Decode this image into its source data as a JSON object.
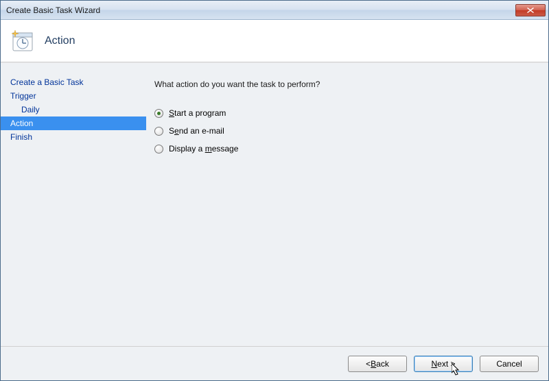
{
  "titlebar": {
    "text": "Create Basic Task Wizard"
  },
  "header": {
    "title": "Action"
  },
  "sidebar": {
    "items": [
      {
        "label": "Create a Basic Task",
        "indent": false,
        "active": false
      },
      {
        "label": "Trigger",
        "indent": false,
        "active": false
      },
      {
        "label": "Daily",
        "indent": true,
        "active": false
      },
      {
        "label": "Action",
        "indent": false,
        "active": true
      },
      {
        "label": "Finish",
        "indent": false,
        "active": false
      }
    ]
  },
  "content": {
    "question": "What action do you want the task to perform?",
    "options": [
      {
        "pre": "",
        "mn": "S",
        "post": "tart a program",
        "checked": true
      },
      {
        "pre": "S",
        "mn": "e",
        "post": "nd an e-mail",
        "checked": false
      },
      {
        "pre": "Display a ",
        "mn": "m",
        "post": "essage",
        "checked": false
      }
    ]
  },
  "footer": {
    "back": {
      "pre": "< ",
      "mn": "B",
      "post": "ack"
    },
    "next": {
      "pre": "",
      "mn": "N",
      "post": "ext >"
    },
    "cancel": {
      "label": "Cancel"
    }
  }
}
